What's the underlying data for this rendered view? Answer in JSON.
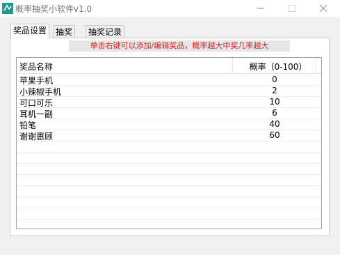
{
  "window": {
    "title": "概率抽奖小软件v1.0"
  },
  "tabs": [
    "奖品设置",
    "抽奖",
    "抽奖记录"
  ],
  "hint": "单击右键可以添加/编辑奖品，概率越大中奖几率越大",
  "table": {
    "columns": [
      "奖品名称",
      "概率（0-100）"
    ],
    "rows": [
      {
        "name": "苹果手机",
        "rate": "0"
      },
      {
        "name": "小辣椒手机",
        "rate": "2"
      },
      {
        "name": "可口可乐",
        "rate": "10"
      },
      {
        "name": "耳机一副",
        "rate": "6"
      },
      {
        "name": "铅笔",
        "rate": "40"
      },
      {
        "name": "谢谢惠顾",
        "rate": "60"
      }
    ]
  },
  "colors": {
    "hint_text": "#e02020",
    "icon": "#1f9a8f"
  },
  "icons": [
    "app-icon",
    "minimize-icon",
    "maximize-icon",
    "close-icon"
  ]
}
